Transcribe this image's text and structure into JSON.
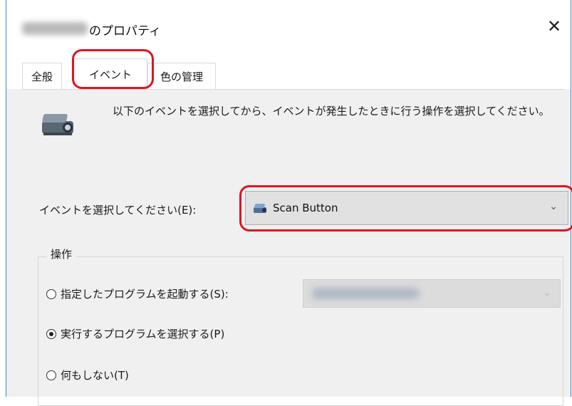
{
  "window": {
    "title": "のプロパティ",
    "close_glyph": "✕"
  },
  "tabs": [
    {
      "label": "全般"
    },
    {
      "label": "イベント"
    },
    {
      "label": "色の管理"
    }
  ],
  "description": "以下のイベントを選択してから、イベントが発生したときに行う操作を選択してください。",
  "event": {
    "label": "イベントを選択してください(E):",
    "selected": "Scan Button",
    "icon": "scanner-icon"
  },
  "actions": {
    "legend": "操作",
    "options": [
      {
        "label": "指定したプログラムを起動する(S):",
        "checked": false
      },
      {
        "label": "実行するプログラムを選択する(P)",
        "checked": true
      },
      {
        "label": "何もしない(T)",
        "checked": false
      }
    ]
  },
  "colors": {
    "highlight": "#e0141e",
    "window_border": "#3c7fd6"
  }
}
